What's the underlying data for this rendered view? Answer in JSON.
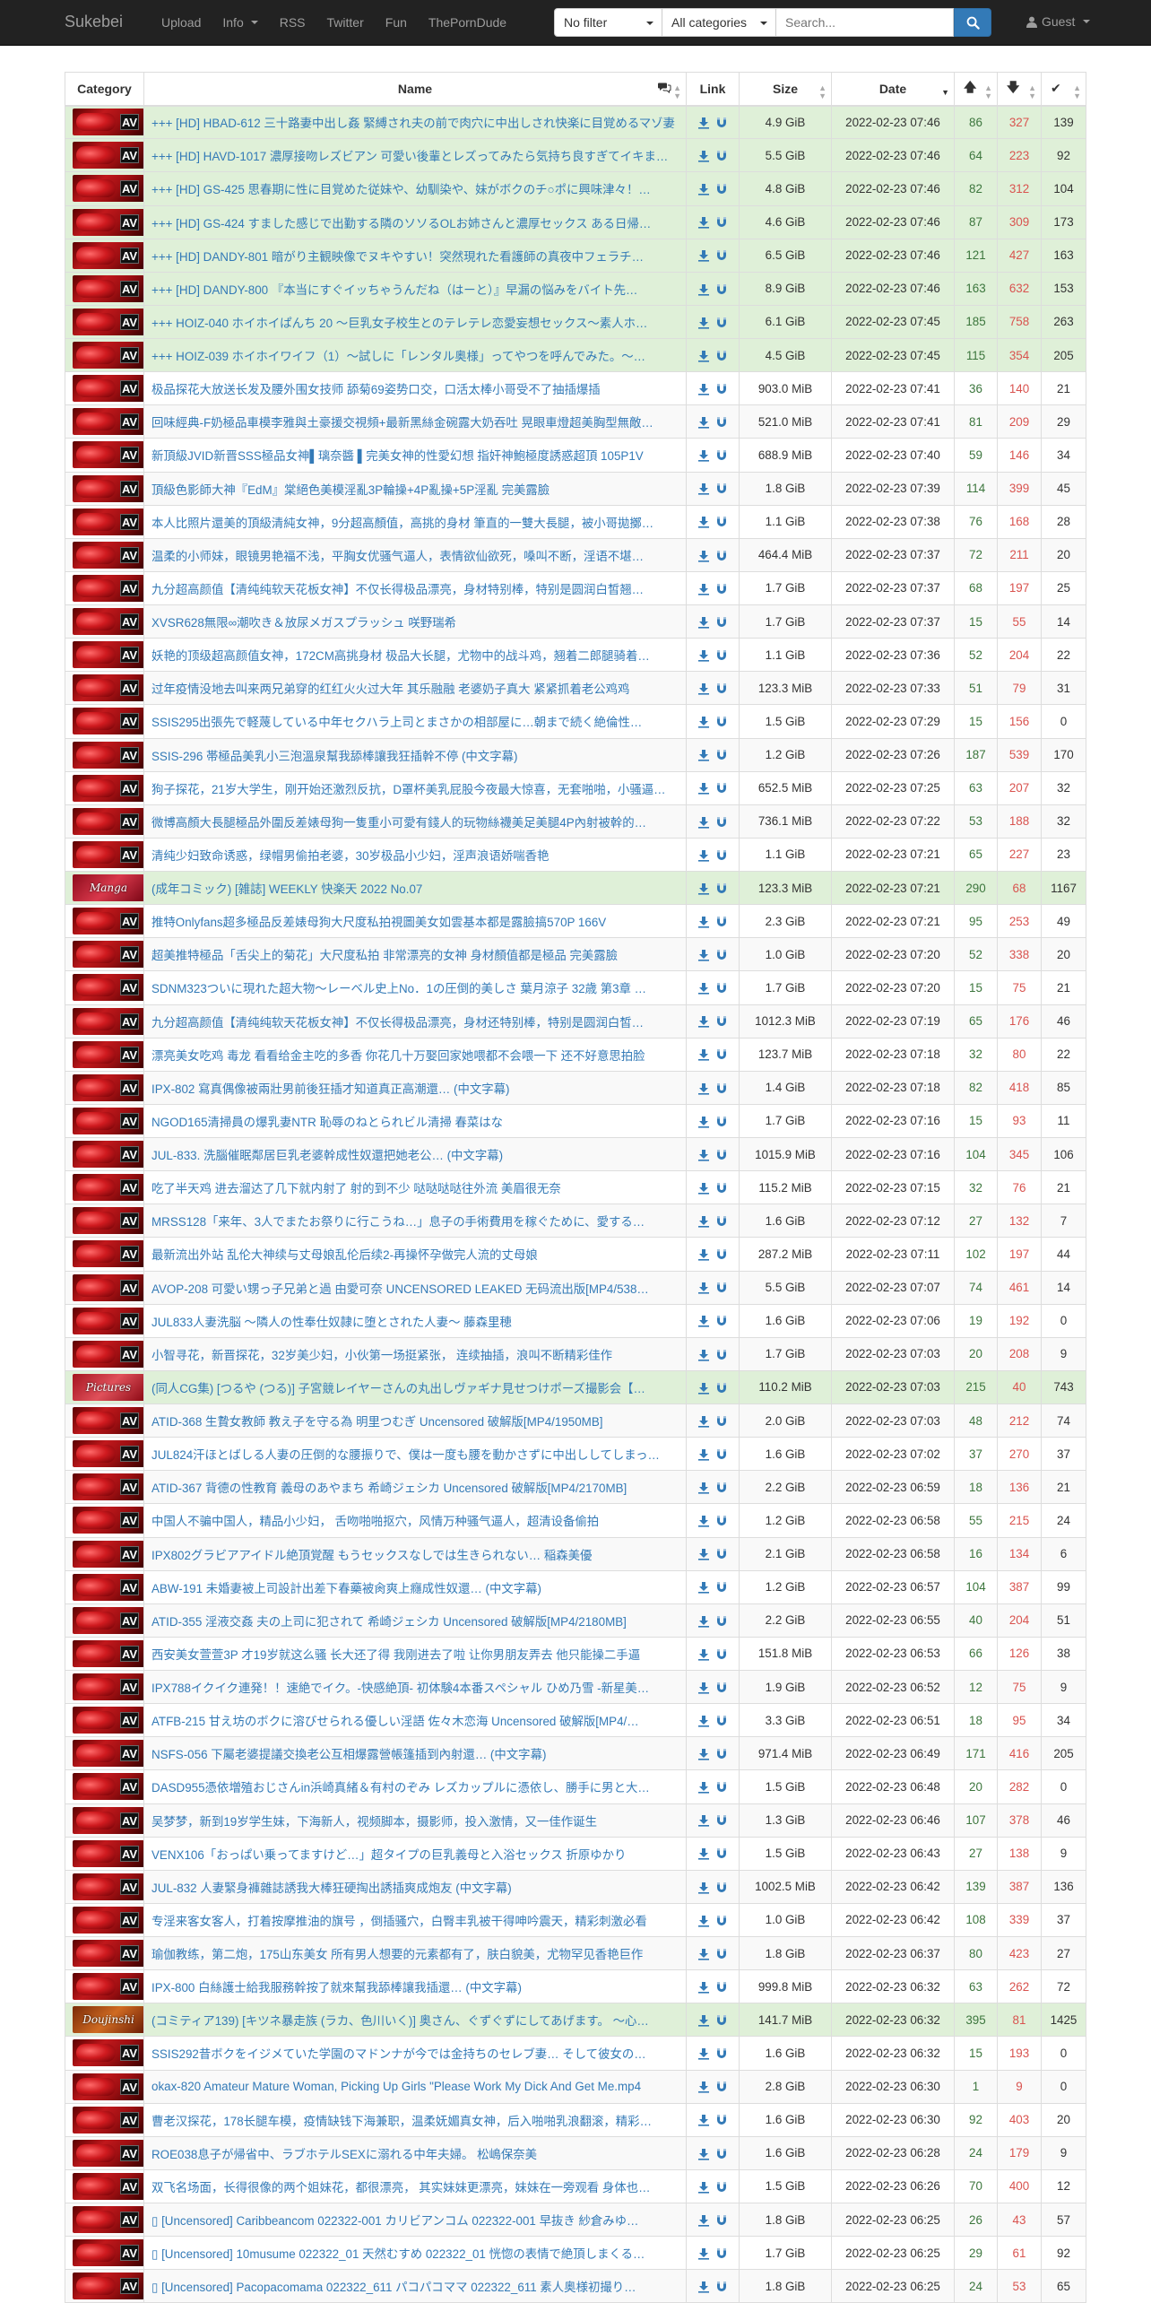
{
  "navbar": {
    "brand": "Sukebei",
    "links": [
      "Upload",
      "Info",
      "RSS",
      "Twitter",
      "Fun",
      "ThePornDude"
    ],
    "filter_select": "No filter",
    "category_select": "All categories",
    "search_placeholder": "Search...",
    "user_menu": "Guest"
  },
  "table": {
    "headers": {
      "category": "Category",
      "name": "Name",
      "link": "Link",
      "size": "Size",
      "date": "Date"
    },
    "rows": [
      {
        "cat": "av",
        "trusted": true,
        "name": "+++ [HD] HBAD-612 三十路妻中出し姦 緊縛され夫の前で肉穴に中出しされ快楽に目覚めるマゾ妻",
        "size": "4.9 GiB",
        "date": "2022-02-23 07:46",
        "seeders": "86",
        "leechers": "327",
        "downloads": "139"
      },
      {
        "cat": "av",
        "trusted": true,
        "name": "+++ [HD] HAVD-1017 濃厚接吻レズビアン 可愛い後輩とレズってみたら気持ち良すぎてイキまくり",
        "size": "5.5 GiB",
        "date": "2022-02-23 07:46",
        "seeders": "64",
        "leechers": "223",
        "downloads": "92"
      },
      {
        "cat": "av",
        "trusted": true,
        "name": "+++ [HD] GS-425 思春期に性に目覚めた従妹や、幼馴染や、妹がボクのチ○ポに興味津々！…",
        "size": "4.8 GiB",
        "date": "2022-02-23 07:46",
        "seeders": "82",
        "leechers": "312",
        "downloads": "104"
      },
      {
        "cat": "av",
        "trusted": true,
        "name": "+++ [HD] GS-424 すました感じで出勤する隣のソソるOLお姉さんと濃厚セックス ある日帰…",
        "size": "4.6 GiB",
        "date": "2022-02-23 07:46",
        "seeders": "87",
        "leechers": "309",
        "downloads": "173"
      },
      {
        "cat": "av",
        "trusted": true,
        "name": "+++ [HD] DANDY-801 暗がり主観映像でヌキやすい！突然現れた看護師の真夜中フェラチ…",
        "size": "6.5 GiB",
        "date": "2022-02-23 07:46",
        "seeders": "121",
        "leechers": "427",
        "downloads": "163"
      },
      {
        "cat": "av",
        "trusted": true,
        "name": "+++ [HD] DANDY-800 『本当にすぐイッちゃうんだね（はーと）』早漏の悩みをバイト先…",
        "size": "8.9 GiB",
        "date": "2022-02-23 07:46",
        "seeders": "163",
        "leechers": "632",
        "downloads": "153"
      },
      {
        "cat": "av",
        "trusted": true,
        "name": "+++ HOIZ-040 ホイホイぱんち 20 ～巨乳女子校生とのテレテレ恋愛妄想セックス～素人ホ…",
        "size": "6.1 GiB",
        "date": "2022-02-23 07:45",
        "seeders": "185",
        "leechers": "758",
        "downloads": "263"
      },
      {
        "cat": "av",
        "trusted": true,
        "name": "+++ HOIZ-039 ホイホイワイフ（1）～試しに「レンタル奥様」ってやつを呼んでみた。～…",
        "size": "4.5 GiB",
        "date": "2022-02-23 07:45",
        "seeders": "115",
        "leechers": "354",
        "downloads": "205"
      },
      {
        "cat": "av",
        "trusted": false,
        "name": "极品探花大放送长发及腰外围女技师 舔菊69姿势口交，口活太棒小哥受不了抽插爆插",
        "size": "903.0 MiB",
        "date": "2022-02-23 07:41",
        "seeders": "36",
        "leechers": "140",
        "downloads": "21"
      },
      {
        "cat": "av",
        "trusted": false,
        "name": "回味經典-F奶極品車模李雅與土豪援交視頻+最新黑絲金碗露大奶吞吐 晃眼車燈超美胸型無敵…",
        "size": "521.0 MiB",
        "date": "2022-02-23 07:41",
        "seeders": "81",
        "leechers": "209",
        "downloads": "29"
      },
      {
        "cat": "av",
        "trusted": false,
        "name": "新頂級JVID新晋SSS極品女神▌璃奈醬 ▌完美女神的性愛幻想 指奸神鮑極度誘惑超頂 105P1V",
        "size": "688.9 MiB",
        "date": "2022-02-23 07:40",
        "seeders": "59",
        "leechers": "146",
        "downloads": "34"
      },
      {
        "cat": "av",
        "trusted": false,
        "name": "頂級色影師大神『EdM』棠絕色美模淫亂3P輪操+4P亂操+5P淫亂 完美露臉",
        "size": "1.8 GiB",
        "date": "2022-02-23 07:39",
        "seeders": "114",
        "leechers": "399",
        "downloads": "45"
      },
      {
        "cat": "av",
        "trusted": false,
        "name": "本人比照片還美的頂級清純女神，9分超高顏值，高挑的身材 筆直的一雙大長腿，被小哥拋擲…",
        "size": "1.1 GiB",
        "date": "2022-02-23 07:38",
        "seeders": "76",
        "leechers": "168",
        "downloads": "28"
      },
      {
        "cat": "av",
        "trusted": false,
        "name": "温柔的小师妹，眼镜男艳福不浅，平胸女优骚气逼人，表情欲仙欲死，嗓叫不断，淫语不堪…",
        "size": "464.4 MiB",
        "date": "2022-02-23 07:37",
        "seeders": "72",
        "leechers": "211",
        "downloads": "20"
      },
      {
        "cat": "av",
        "trusted": false,
        "name": "九分超高颜值【清纯纯软天花板女神】不仅长得极品漂亮，身材特别棒，特别是圆润白皙翘…",
        "size": "1.7 GiB",
        "date": "2022-02-23 07:37",
        "seeders": "68",
        "leechers": "197",
        "downloads": "25"
      },
      {
        "cat": "av",
        "trusted": false,
        "name": "XVSR628無限∞潮吹き＆放尿メガスプラッシュ 咲野瑞希",
        "size": "1.7 GiB",
        "date": "2022-02-23 07:37",
        "seeders": "15",
        "leechers": "55",
        "downloads": "14"
      },
      {
        "cat": "av",
        "trusted": false,
        "name": "妖艳的顶级超高颜值女神，172CM高挑身材 极品大长腿，尤物中的战斗鸡，翘着二郎腿骑着…",
        "size": "1.1 GiB",
        "date": "2022-02-23 07:36",
        "seeders": "52",
        "leechers": "204",
        "downloads": "22"
      },
      {
        "cat": "av",
        "trusted": false,
        "name": "过年疫情没地去叫来两兄弟穿的红红火火过大年 其乐融融 老婆奶子真大 紧紧抓着老公鸡鸡",
        "size": "123.3 MiB",
        "date": "2022-02-23 07:33",
        "seeders": "51",
        "leechers": "79",
        "downloads": "31"
      },
      {
        "cat": "av",
        "trusted": false,
        "name": "SSIS295出張先で軽蔑している中年セクハラ上司とまさかの相部屋に…朝まで続く絶倫性…",
        "size": "1.5 GiB",
        "date": "2022-02-23 07:29",
        "seeders": "15",
        "leechers": "156",
        "downloads": "0"
      },
      {
        "cat": "av",
        "trusted": false,
        "name": "SSIS-296 帯極品美乳小三泡溫泉幫我舔棒讓我狂插幹不停 (中文字幕)",
        "size": "1.2 GiB",
        "date": "2022-02-23 07:26",
        "seeders": "187",
        "leechers": "539",
        "downloads": "170"
      },
      {
        "cat": "av",
        "trusted": false,
        "name": "狗子探花，21岁大学生，刚开始还激烈反抗，D罩杯美乳屁股今夜最大惊喜，无套啪啪，小骚逼…",
        "size": "652.5 MiB",
        "date": "2022-02-23 07:25",
        "seeders": "63",
        "leechers": "207",
        "downloads": "32"
      },
      {
        "cat": "av",
        "trusted": false,
        "name": "微博高顏大長腿極品外圍反差婊母狗一隻重小可愛有錢人的玩物絲襪美足美腿4P內射被幹的…",
        "size": "736.1 MiB",
        "date": "2022-02-23 07:22",
        "seeders": "53",
        "leechers": "188",
        "downloads": "32"
      },
      {
        "cat": "av",
        "trusted": false,
        "name": "清纯少妇致命诱惑，绿帽男偷拍老婆，30岁极品小少妇，淫声浪语娇喘香艳",
        "size": "1.1 GiB",
        "date": "2022-02-23 07:21",
        "seeders": "65",
        "leechers": "227",
        "downloads": "23"
      },
      {
        "cat": "manga",
        "trusted": true,
        "name": "(成年コミック) [雑誌] WEEKLY 快楽天 2022 No.07",
        "size": "123.3 MiB",
        "date": "2022-02-23 07:21",
        "seeders": "290",
        "leechers": "68",
        "downloads": "1167"
      },
      {
        "cat": "av",
        "trusted": false,
        "name": "推特Onlyfans超多極品反差婊母狗大尺度私拍視圖美女如雲基本都是露臉搞570P 166V",
        "size": "2.3 GiB",
        "date": "2022-02-23 07:21",
        "seeders": "95",
        "leechers": "253",
        "downloads": "49"
      },
      {
        "cat": "av",
        "trusted": false,
        "name": "超美推特極品「舌尖上的菊花」大尺度私拍 非常漂亮的女神 身材顏值都是極品 完美露臉",
        "size": "1.0 GiB",
        "date": "2022-02-23 07:20",
        "seeders": "52",
        "leechers": "338",
        "downloads": "20"
      },
      {
        "cat": "av",
        "trusted": false,
        "name": "SDNM323ついに現れた超大物～レーベル史上No．1の圧倒的美しさ 葉月涼子 32歳 第3章 …",
        "size": "1.7 GiB",
        "date": "2022-02-23 07:20",
        "seeders": "15",
        "leechers": "75",
        "downloads": "21"
      },
      {
        "cat": "av",
        "trusted": false,
        "name": "九分超高颜值【清纯纯软天花板女神】不仅长得极品漂亮，身材还特别棒，特别是圆润白皙…",
        "size": "1012.3 MiB",
        "date": "2022-02-23 07:19",
        "seeders": "65",
        "leechers": "176",
        "downloads": "46"
      },
      {
        "cat": "av",
        "trusted": false,
        "name": "漂亮美女吃鸡 毒龙 看看给金主吃的多香 你花几十万娶回家她喂都不会喂一下 还不好意思拍脸",
        "size": "123.7 MiB",
        "date": "2022-02-23 07:18",
        "seeders": "32",
        "leechers": "80",
        "downloads": "22"
      },
      {
        "cat": "av",
        "trusted": false,
        "name": "IPX-802 寫真偶像被兩壯男前後狂插才知道真正高潮還… (中文字幕)",
        "size": "1.4 GiB",
        "date": "2022-02-23 07:18",
        "seeders": "82",
        "leechers": "418",
        "downloads": "85"
      },
      {
        "cat": "av",
        "trusted": false,
        "name": "NGOD165清掃員の爆乳妻NTR 恥辱のねとられビル清掃 春菜はな",
        "size": "1.7 GiB",
        "date": "2022-02-23 07:16",
        "seeders": "15",
        "leechers": "93",
        "downloads": "11"
      },
      {
        "cat": "av",
        "trusted": false,
        "name": "JUL-833. 洗腦催眠鄰居巨乳老婆幹成性奴還把她老公… (中文字幕)",
        "size": "1015.9 MiB",
        "date": "2022-02-23 07:16",
        "seeders": "104",
        "leechers": "345",
        "downloads": "106"
      },
      {
        "cat": "av",
        "trusted": false,
        "name": "吃了半天鸡 进去溜达了几下就内射了 射的到不少 哒哒哒哒往外流 美眉很无奈",
        "size": "115.2 MiB",
        "date": "2022-02-23 07:15",
        "seeders": "32",
        "leechers": "76",
        "downloads": "21"
      },
      {
        "cat": "av",
        "trusted": false,
        "name": "MRSS128「来年、3人でまたお祭りに行こうね…」息子の手術費用を稼ぐために、愛する…",
        "size": "1.6 GiB",
        "date": "2022-02-23 07:12",
        "seeders": "27",
        "leechers": "132",
        "downloads": "7"
      },
      {
        "cat": "av",
        "trusted": false,
        "name": "最新流出外站 乱伦大神续与丈母娘乱伦后续2-再操怀孕做完人流的丈母娘",
        "size": "287.2 MiB",
        "date": "2022-02-23 07:11",
        "seeders": "102",
        "leechers": "197",
        "downloads": "44"
      },
      {
        "cat": "av",
        "trusted": false,
        "name": "AVOP-208 可愛い甥っ子兄弟と過 由愛可奈 UNCENSORED LEAKED 无码流出版[MP4/538…",
        "size": "5.5 GiB",
        "date": "2022-02-23 07:07",
        "seeders": "74",
        "leechers": "461",
        "downloads": "14"
      },
      {
        "cat": "av",
        "trusted": false,
        "name": "JUL833人妻洗脳 ～隣人の性奉仕奴隷に堕とされた人妻～ 藤森里穂",
        "size": "1.6 GiB",
        "date": "2022-02-23 07:06",
        "seeders": "19",
        "leechers": "192",
        "downloads": "0"
      },
      {
        "cat": "av",
        "trusted": false,
        "name": "小智寻花，新晋探花，32岁美少妇，小伙第一场挺紧张， 连续抽插，浪叫不断精彩佳作",
        "size": "1.7 GiB",
        "date": "2022-02-23 07:03",
        "seeders": "20",
        "leechers": "208",
        "downloads": "9"
      },
      {
        "cat": "pictures",
        "trusted": true,
        "name": "(同人CG集) [つるや (つる)] 子宮競レイヤーさんの丸出しヴァギナ見せつけポーズ撮影会【…",
        "size": "110.2 MiB",
        "date": "2022-02-23 07:03",
        "seeders": "215",
        "leechers": "40",
        "downloads": "743"
      },
      {
        "cat": "av",
        "trusted": false,
        "name": "ATID-368 生贄女教師 教え子を守る為 明里つむぎ Uncensored 破解版[MP4/1950MB]",
        "size": "2.0 GiB",
        "date": "2022-02-23 07:03",
        "seeders": "48",
        "leechers": "212",
        "downloads": "74"
      },
      {
        "cat": "av",
        "trusted": false,
        "name": "JUL824汗ほとばしる人妻の圧倒的な腰振りで、僕は一度も腰を動かさずに中出ししてしまっ…",
        "size": "1.6 GiB",
        "date": "2022-02-23 07:02",
        "seeders": "37",
        "leechers": "270",
        "downloads": "37"
      },
      {
        "cat": "av",
        "trusted": false,
        "name": "ATID-367 背德の性教育 義母のあやまち 希崎ジェシカ Uncensored 破解版[MP4/2170MB]",
        "size": "2.2 GiB",
        "date": "2022-02-23 06:59",
        "seeders": "18",
        "leechers": "136",
        "downloads": "21"
      },
      {
        "cat": "av",
        "trusted": false,
        "name": "中国人不骗中国人，精品小少妇， 舌吻啪啪抠穴，风情万种骚气逼人，超清设备偷拍",
        "size": "1.2 GiB",
        "date": "2022-02-23 06:58",
        "seeders": "55",
        "leechers": "215",
        "downloads": "24"
      },
      {
        "cat": "av",
        "trusted": false,
        "name": "IPX802グラビアアイドル絶頂覚醒 もうセックスなしでは生きられない… 稲森美優",
        "size": "2.1 GiB",
        "date": "2022-02-23 06:58",
        "seeders": "16",
        "leechers": "134",
        "downloads": "6"
      },
      {
        "cat": "av",
        "trusted": false,
        "name": "ABW-191 未婚妻被上司設計出差下春藥被肏爽上癮成性奴還… (中文字幕)",
        "size": "1.2 GiB",
        "date": "2022-02-23 06:57",
        "seeders": "104",
        "leechers": "387",
        "downloads": "99"
      },
      {
        "cat": "av",
        "trusted": false,
        "name": "ATID-355 淫液交姦 夫の上司に犯されて 希崎ジェシカ Uncensored 破解版[MP4/2180MB]",
        "size": "2.2 GiB",
        "date": "2022-02-23 06:55",
        "seeders": "40",
        "leechers": "204",
        "downloads": "51"
      },
      {
        "cat": "av",
        "trusted": false,
        "name": "西安美女萱萱3P 才19岁就这么骚 长大还了得 我刚进去了啦 让你男朋友弄去 他只能操二手逼",
        "size": "151.8 MiB",
        "date": "2022-02-23 06:53",
        "seeders": "66",
        "leechers": "126",
        "downloads": "38"
      },
      {
        "cat": "av",
        "trusted": false,
        "name": "IPX788イクイク連発！！速絶でイク。-快感絶頂- 初体験4本番スペシャル ひめ乃雪 -新星美…",
        "size": "1.9 GiB",
        "date": "2022-02-23 06:52",
        "seeders": "12",
        "leechers": "75",
        "downloads": "9"
      },
      {
        "cat": "av",
        "trusted": false,
        "name": "ATFB-215 甘え坊のボクに溶びせられる優しい淫語 佐々木恋海 Uncensored 破解版[MP4/…",
        "size": "3.3 GiB",
        "date": "2022-02-23 06:51",
        "seeders": "18",
        "leechers": "95",
        "downloads": "34"
      },
      {
        "cat": "av",
        "trusted": false,
        "name": "NSFS-056 下屬老婆提議交換老公互相爆露營帳篷插到內射還… (中文字幕)",
        "size": "971.4 MiB",
        "date": "2022-02-23 06:49",
        "seeders": "171",
        "leechers": "416",
        "downloads": "205"
      },
      {
        "cat": "av",
        "trusted": false,
        "name": "DASD955憑依増殖おじさんin浜崎真緒＆有村のぞみ レズカップルに憑依し、勝手に男と大…",
        "size": "1.5 GiB",
        "date": "2022-02-23 06:48",
        "seeders": "20",
        "leechers": "282",
        "downloads": "0"
      },
      {
        "cat": "av",
        "trusted": false,
        "name": "吴梦梦，新到19岁学生妹，下海新人，视频脚本，摄影师，投入激情，又一佳作诞生",
        "size": "1.3 GiB",
        "date": "2022-02-23 06:46",
        "seeders": "107",
        "leechers": "378",
        "downloads": "46"
      },
      {
        "cat": "av",
        "trusted": false,
        "name": "VENX106「おっぱい乗ってますけど…」超タイプの巨乳義母と入浴セックス 折原ゆかり",
        "size": "1.5 GiB",
        "date": "2022-02-23 06:43",
        "seeders": "27",
        "leechers": "138",
        "downloads": "9"
      },
      {
        "cat": "av",
        "trusted": false,
        "name": "JUL-832 人妻緊身褲雜誌誘我大棒狂硬掏出誘插爽成炮友 (中文字幕)",
        "size": "1002.5 MiB",
        "date": "2022-02-23 06:42",
        "seeders": "139",
        "leechers": "387",
        "downloads": "136"
      },
      {
        "cat": "av",
        "trusted": false,
        "name": "专淫来客女客人，打着按摩推油的旗号 ，倒插骚穴，白臀丰乳被干得呻吟震天，精彩刺激必看",
        "size": "1.0 GiB",
        "date": "2022-02-23 06:42",
        "seeders": "108",
        "leechers": "339",
        "downloads": "37"
      },
      {
        "cat": "av",
        "trusted": false,
        "name": "瑜伽教练，第二炮，175山东美女 所有男人想要的元素都有了，肤白貌美，尤物罕见香艳巨作",
        "size": "1.8 GiB",
        "date": "2022-02-23 06:37",
        "seeders": "80",
        "leechers": "423",
        "downloads": "27"
      },
      {
        "cat": "av",
        "trusted": false,
        "name": "IPX-800 白絲護士給我服務幹按了就來幫我舔棒讓我插還… (中文字幕)",
        "size": "999.8 MiB",
        "date": "2022-02-23 06:32",
        "seeders": "63",
        "leechers": "262",
        "downloads": "72"
      },
      {
        "cat": "doujinshi",
        "trusted": true,
        "name": "(コミティア139) [キツネ暴走族 (ラカ、色川いく)] 奥さん、ぐずぐずにしてあげます。 ～心…",
        "size": "141.7 MiB",
        "date": "2022-02-23 06:32",
        "seeders": "395",
        "leechers": "81",
        "downloads": "1425"
      },
      {
        "cat": "av",
        "trusted": false,
        "name": "SSIS292昔ボクをイジメていた学園のマドンナが今では金持ちのセレブ妻… そして彼女の…",
        "size": "1.6 GiB",
        "date": "2022-02-23 06:32",
        "seeders": "15",
        "leechers": "193",
        "downloads": "0"
      },
      {
        "cat": "av",
        "trusted": false,
        "name": "okax-820 Amateur Mature Woman, Picking Up Girls \"Please Work My Dick And Get Me.mp4",
        "size": "2.8 GiB",
        "date": "2022-02-23 06:30",
        "seeders": "1",
        "leechers": "9",
        "downloads": "0"
      },
      {
        "cat": "av",
        "trusted": false,
        "name": "曹老汉探花，178长腿车模，疫情缺钱下海兼职，温柔妩媚真女神，后入啪啪乳浪翻滚，精彩…",
        "size": "1.6 GiB",
        "date": "2022-02-23 06:30",
        "seeders": "92",
        "leechers": "403",
        "downloads": "20"
      },
      {
        "cat": "av",
        "trusted": false,
        "name": "ROE038息子が帰省中、ラブホテルSEXに溺れる中年夫婦。 松嶋保奈美",
        "size": "1.6 GiB",
        "date": "2022-02-23 06:28",
        "seeders": "24",
        "leechers": "179",
        "downloads": "9"
      },
      {
        "cat": "av",
        "trusted": false,
        "name": "双飞名场面，长得很像的两个姐妹花，都很漂亮， 其实妹妹更漂亮，妹妹在一旁观看 身体也…",
        "size": "1.5 GiB",
        "date": "2022-02-23 06:26",
        "seeders": "70",
        "leechers": "400",
        "downloads": "12"
      },
      {
        "cat": "av",
        "trusted": false,
        "name": "▯ [Uncensored] Caribbeancom 022322-001 カリビアンコム 022322-001 早抜き 紗倉みゆ…",
        "size": "1.8 GiB",
        "date": "2022-02-23 06:25",
        "seeders": "26",
        "leechers": "43",
        "downloads": "57"
      },
      {
        "cat": "av",
        "trusted": false,
        "name": "▯ [Uncensored] 10musume 022322_01 天然むすめ 022322_01 恍惚の表情で絶頂しまくる…",
        "size": "1.7 GiB",
        "date": "2022-02-23 06:25",
        "seeders": "29",
        "leechers": "61",
        "downloads": "92"
      },
      {
        "cat": "av",
        "trusted": false,
        "name": "▯ [Uncensored] Pacopacomama 022322_611 パコパコママ 022322_611 素人奥様初撮り…",
        "size": "1.8 GiB",
        "date": "2022-02-23 06:25",
        "seeders": "24",
        "leechers": "53",
        "downloads": "65"
      }
    ]
  }
}
